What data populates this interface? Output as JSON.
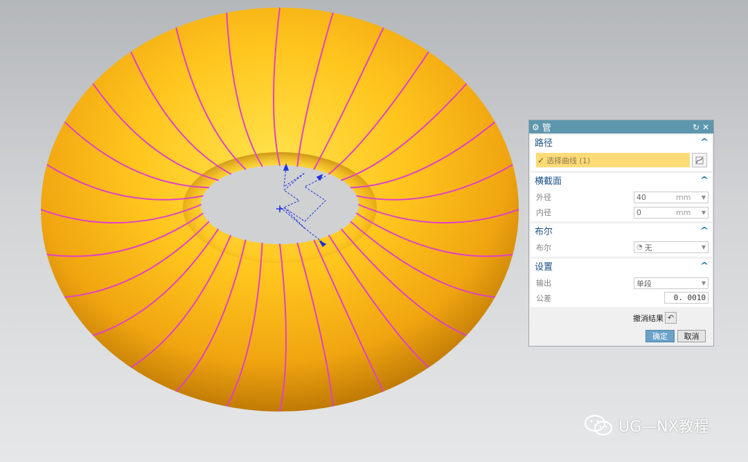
{
  "dialog": {
    "title": "管",
    "sections": {
      "path": {
        "heading": "路径",
        "select_curve": "选择曲线 (1)"
      },
      "cross_section": {
        "heading": "横截面",
        "outer_diameter_label": "外径",
        "outer_diameter_value": "40",
        "outer_diameter_unit": "mm",
        "inner_diameter_label": "内径",
        "inner_diameter_value": "0",
        "inner_diameter_unit": "mm"
      },
      "boolean": {
        "heading": "布尔",
        "label": "布尔",
        "value": "无"
      },
      "settings": {
        "heading": "设置",
        "output_label": "输出",
        "output_value": "单段",
        "tolerance_label": "公差",
        "tolerance_value": "0. 0010"
      }
    },
    "undo_result_label": "撤消结果",
    "ok_label": "确定",
    "cancel_label": "取消"
  },
  "watermark": {
    "text": "UG—NX教程"
  },
  "colors": {
    "torus": "#ffc21a",
    "curves": "#e040c8",
    "path_sketch": "#2030e0",
    "titlebar": "#5e97ad",
    "section_heading": "#1b4f86",
    "selection_highlight": "#ffdb78"
  }
}
